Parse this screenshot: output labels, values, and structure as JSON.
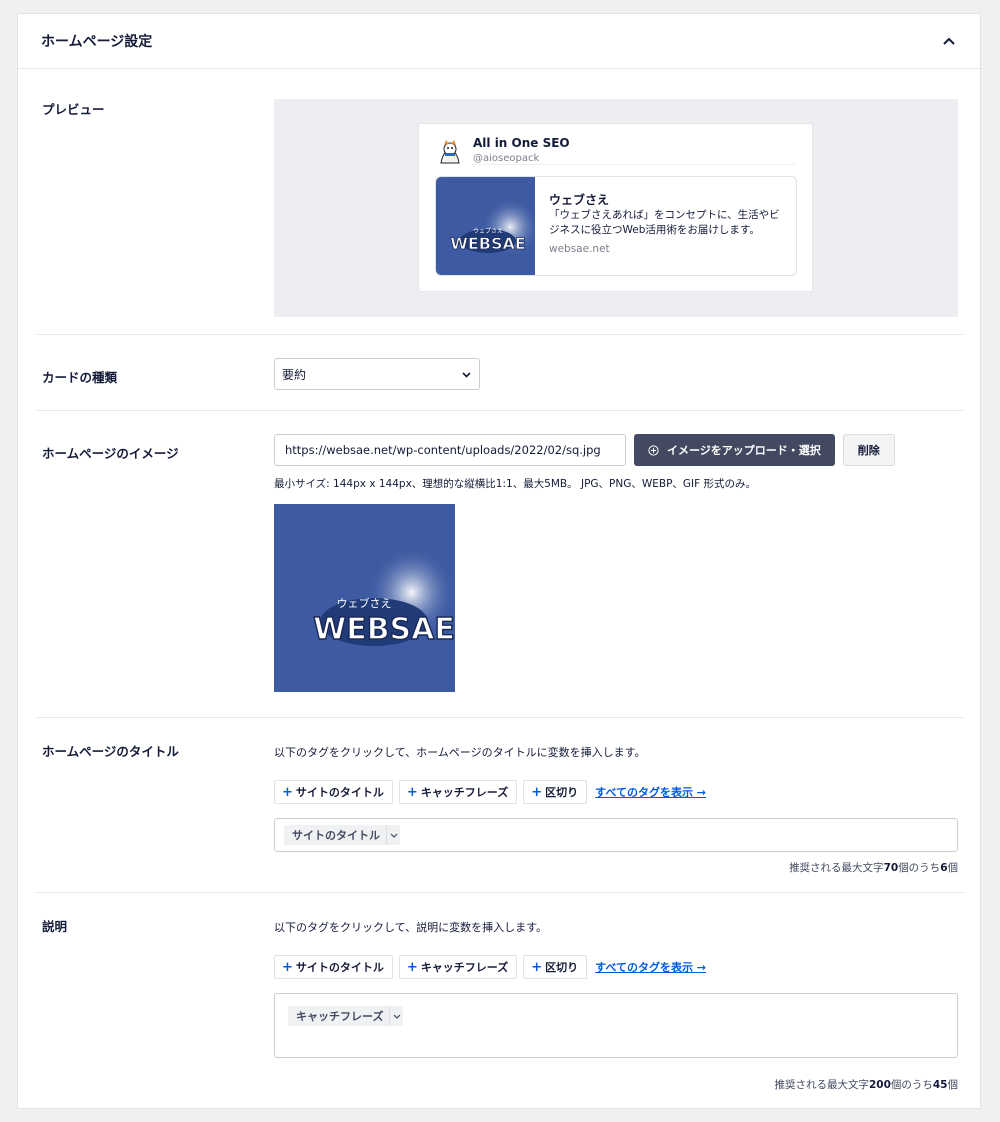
{
  "panel": {
    "title": "ホームページ設定"
  },
  "preview": {
    "label": "プレビュー",
    "account_name": "All in One SEO",
    "account_handle": "@aioseopack",
    "site_title": "ウェブさえ",
    "site_desc": "「ウェブさえあれば」をコンセプトに、生活やビジネスに役立つWeb活用術をお届けします。",
    "site_domain": "websae.net",
    "logo_small": "ウェブさえ",
    "logo_big": "WEBSAE"
  },
  "card_type": {
    "label": "カードの種類",
    "value": "要約"
  },
  "image": {
    "label": "ホームページのイメージ",
    "url": "https://websae.net/wp-content/uploads/2022/02/sq.jpg",
    "upload_button": "イメージをアップロード・選択",
    "delete_button": "削除",
    "hint": "最小サイズ: 144px x 144px、理想的な縦横比1:1、最大5MB。 JPG、PNG、WEBP、GIF 形式のみ。"
  },
  "title_field": {
    "label": "ホームページのタイトル",
    "instruction": "以下のタグをクリックして、ホームページのタイトルに変数を挿入します。",
    "tags": [
      "サイトのタイトル",
      "キャッチフレーズ",
      "区切り"
    ],
    "show_all": "すべてのタグを表示 →",
    "chip": "サイトのタイトル",
    "count_prefix": "推奨される最大文字",
    "count_max": "70",
    "count_mid": "個のうち",
    "count_cur": "6",
    "count_suffix": "個"
  },
  "desc_field": {
    "label": "説明",
    "instruction": "以下のタグをクリックして、説明に変数を挿入します。",
    "tags": [
      "サイトのタイトル",
      "キャッチフレーズ",
      "区切り"
    ],
    "show_all": "すべてのタグを表示 →",
    "chip": "キャッチフレーズ",
    "count_prefix": "推奨される最大文字",
    "count_max": "200",
    "count_mid": "個のうち",
    "count_cur": "45",
    "count_suffix": "個"
  },
  "colors": {
    "accent": "#005ae0",
    "dark_button": "#434960",
    "logo_bg": "#3d5aa2"
  }
}
